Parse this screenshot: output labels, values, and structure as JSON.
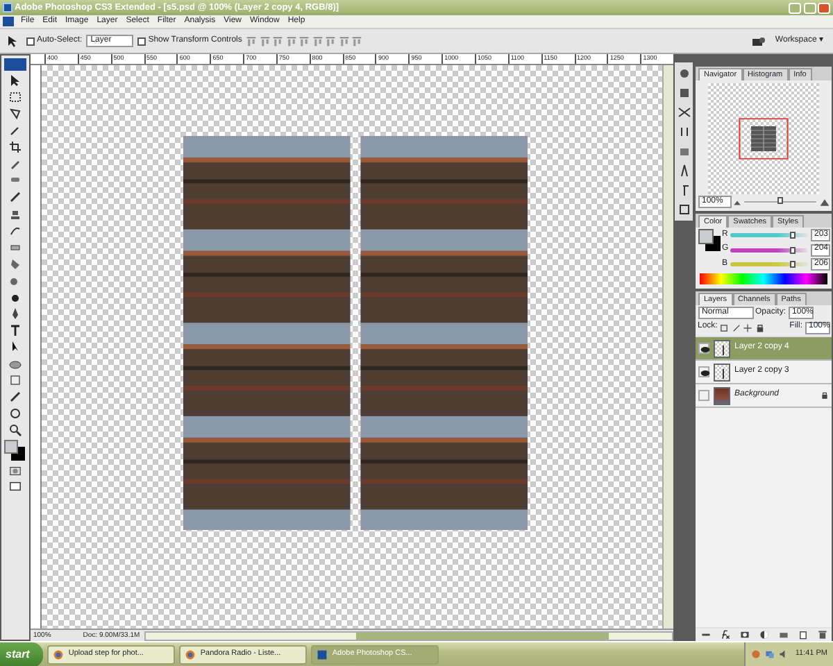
{
  "window": {
    "title": "Adobe Photoshop CS3 Extended - [s5.psd @ 100% (Layer 2 copy 4, RGB/8)]"
  },
  "menus": [
    "File",
    "Edit",
    "Image",
    "Layer",
    "Select",
    "Filter",
    "Analysis",
    "View",
    "Window",
    "Help"
  ],
  "options_bar": {
    "auto_select": {
      "label": "Auto-Select:",
      "checked": false
    },
    "auto_select_target": "Layer",
    "show_transform": {
      "label": "Show Transform Controls",
      "checked": false
    },
    "workspace": "Workspace ▾"
  },
  "ruler_labels": [
    "400",
    "450",
    "500",
    "550",
    "600",
    "650",
    "700",
    "750",
    "800",
    "850",
    "900",
    "950",
    "1000",
    "1050",
    "1100",
    "1150",
    "1200",
    "1250",
    "1300"
  ],
  "status_bar": {
    "zoom": "100%",
    "doc": "Doc: 9.00M/33.1M"
  },
  "navigator": {
    "tabs": [
      {
        "label": "Navigator",
        "selected": true
      },
      {
        "label": "Histogram",
        "selected": false
      },
      {
        "label": "Info",
        "selected": false
      }
    ],
    "zoom": "100%",
    "level": 0.5
  },
  "color": {
    "tabs": [
      {
        "label": "Color",
        "selected": true
      },
      {
        "label": "Swatches",
        "selected": false
      },
      {
        "label": "Styles",
        "selected": false
      }
    ],
    "channels": [
      {
        "label": "R",
        "value": "203",
        "level": 0.8,
        "color": "#4fc9c9"
      },
      {
        "label": "G",
        "value": "204",
        "level": 0.8,
        "color": "#c040c0"
      },
      {
        "label": "B",
        "value": "206",
        "level": 0.81,
        "color": "#c8c840"
      }
    ]
  },
  "layers": {
    "tabs": [
      {
        "label": "Layers",
        "selected": true
      },
      {
        "label": "Channels",
        "selected": false
      },
      {
        "label": "Paths",
        "selected": false
      }
    ],
    "blend_mode": "Normal",
    "opacity_label": "Opacity:",
    "opacity": "100%",
    "lock_label": "Lock:",
    "fill_label": "Fill:",
    "fill": "100%",
    "items": [
      {
        "name": "Layer 2 copy 4",
        "visible": true,
        "selected": true,
        "locked": false,
        "kind": "layer"
      },
      {
        "name": "Layer 2 copy 3",
        "visible": true,
        "selected": false,
        "locked": false,
        "kind": "layer"
      },
      {
        "name": "Background",
        "visible": false,
        "selected": false,
        "locked": true,
        "kind": "background"
      }
    ]
  },
  "taskbar": {
    "start": "start",
    "items": [
      {
        "label": "Upload step for phot...",
        "selected": false,
        "kind": "browser"
      },
      {
        "label": "Pandora Radio - Liste...",
        "selected": false,
        "kind": "browser"
      },
      {
        "label": "Adobe Photoshop CS...",
        "selected": true,
        "kind": "photoshop"
      }
    ],
    "clock": "11:41 PM"
  }
}
